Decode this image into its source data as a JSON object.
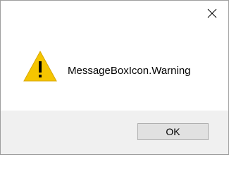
{
  "dialog": {
    "message": "MessageBoxIcon.Warning",
    "icon": "warning-icon",
    "buttons": {
      "ok_label": "OK"
    },
    "titlebar": {
      "close_icon": "close-icon"
    }
  },
  "colors": {
    "warning_fill": "#f5c500",
    "warning_glyph": "#000000",
    "footer_background": "#f0f0f0",
    "button_background": "#e1e1e1",
    "button_border": "#adadad"
  }
}
